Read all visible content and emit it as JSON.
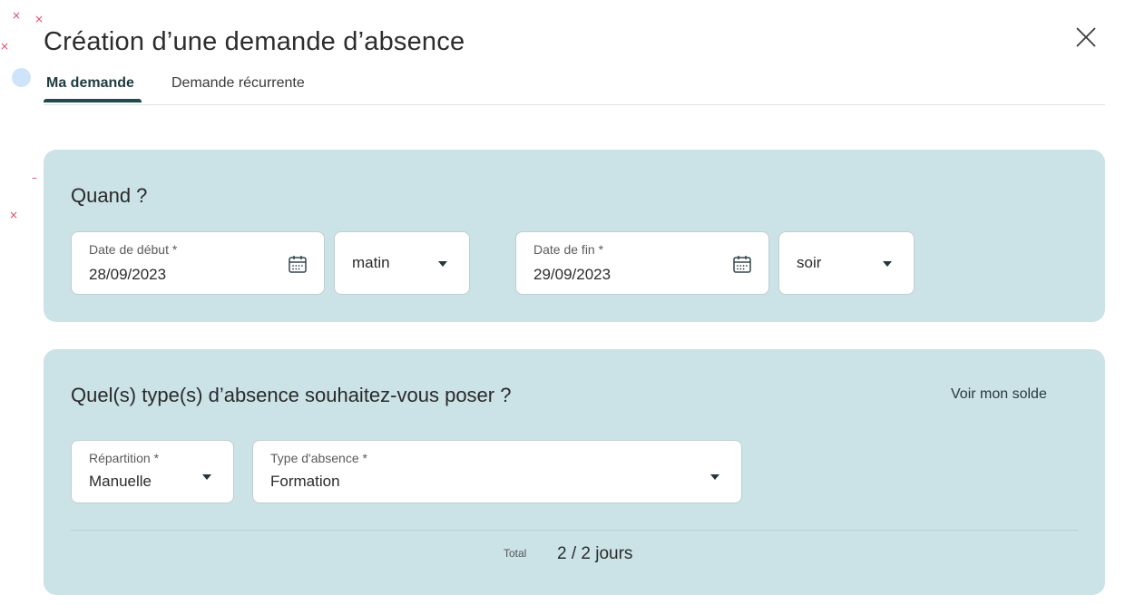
{
  "dialog": {
    "title": "Création d’une demande d’absence",
    "close_icon": "close-icon"
  },
  "tabs": [
    {
      "label": "Ma demande",
      "active": true
    },
    {
      "label": "Demande récurrente",
      "active": false
    }
  ],
  "when": {
    "heading": "Quand ?",
    "start_date": {
      "label": "Date de début *",
      "value": "28/09/2023",
      "icon": "calendar-icon"
    },
    "start_period": {
      "value": "matin"
    },
    "end_date": {
      "label": "Date de fin *",
      "value": "29/09/2023",
      "icon": "calendar-icon"
    },
    "end_period": {
      "value": "soir"
    }
  },
  "type": {
    "heading": "Quel(s) type(s) d’absence souhaitez-vous poser ?",
    "balance_link": "Voir mon solde",
    "repartition": {
      "label": "Répartition *",
      "value": "Manuelle"
    },
    "absence_type": {
      "label": "Type d'absence *",
      "value": "Formation"
    },
    "total_label": "Total",
    "total_value": "2 / 2 jours"
  },
  "colors": {
    "panel_bg": "#cbe2e6",
    "accent": "#1e4a50",
    "decoration": "#e24a6a"
  }
}
